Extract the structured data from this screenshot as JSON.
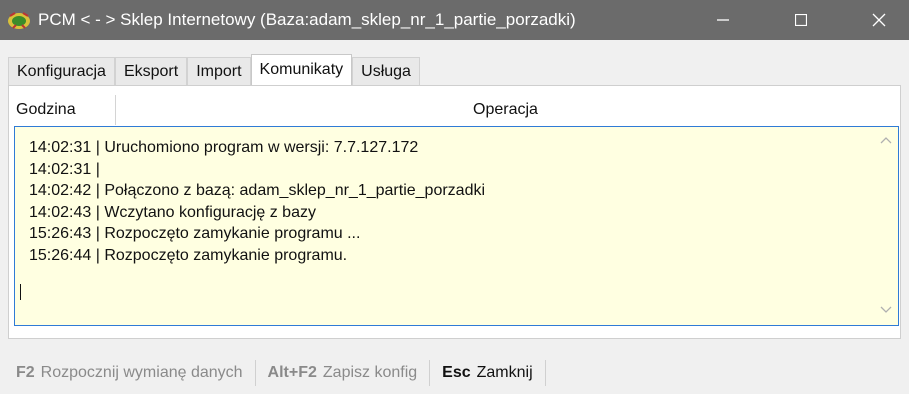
{
  "window": {
    "title": "PCM  < - > Sklep Internetowy (Baza:adam_sklep_nr_1_partie_porzadki)"
  },
  "tabs": [
    {
      "label": "Konfiguracja"
    },
    {
      "label": "Eksport"
    },
    {
      "label": "Import"
    },
    {
      "label": "Komunikaty",
      "active": true
    },
    {
      "label": "Usługa"
    }
  ],
  "table": {
    "columns": [
      "Godzina",
      "Operacja"
    ],
    "log_lines": [
      "14:02:31 | Uruchomiono program w wersji: 7.7.127.172",
      "14:02:31 |",
      "14:02:42 | Połączono z bazą: adam_sklep_nr_1_partie_porzadki",
      "14:02:43 | Wczytano konfigurację z bazy",
      "15:26:43 | Rozpoczęto zamykanie programu ...",
      "15:26:44 | Rozpoczęto zamykanie programu."
    ]
  },
  "statusbar": [
    {
      "key": "F2",
      "label": "Rozpocznij wymianę danych",
      "enabled": false
    },
    {
      "key": "Alt+F2",
      "label": "Zapisz konfig",
      "enabled": false
    },
    {
      "key": "Esc",
      "label": "Zamknij",
      "enabled": true
    }
  ],
  "colors": {
    "titlebar": "#6b6b6b",
    "log_background": "#ffffe1",
    "focus_border": "#2f7bd6"
  },
  "icons": [
    "app-logo-icon",
    "minimize-icon",
    "maximize-icon",
    "close-icon",
    "chevron-up-icon",
    "chevron-down-icon"
  ]
}
